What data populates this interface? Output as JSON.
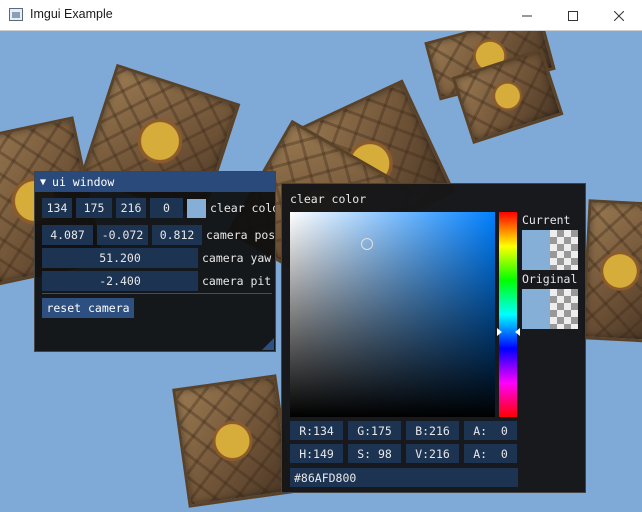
{
  "window": {
    "title": "Imgui Example",
    "minimize_icon": "minimize-icon",
    "maximize_icon": "maximize-icon",
    "close_icon": "close-icon"
  },
  "colors": {
    "background": "#86AFD8",
    "imgui_header": "#294A7A",
    "imgui_field": "#1D3352",
    "imgui_button": "#2D5080"
  },
  "ui_window": {
    "title": "ui window",
    "collapse_icon": "triangle-down-icon",
    "clear_color": {
      "r": "134",
      "g": "175",
      "b": "216",
      "a": "0",
      "label": "clear colo"
    },
    "camera_pos": {
      "x": "4.087",
      "y": "-0.072",
      "z": "0.812",
      "label": "camera pos"
    },
    "camera_yaw": {
      "value": "51.200",
      "label": "camera yaw"
    },
    "camera_pitch": {
      "value": "-2.400",
      "label": "camera pit"
    },
    "reset_button": "reset camera"
  },
  "color_picker": {
    "title": "clear color",
    "current_label": "Current",
    "original_label": "Original",
    "rgba": {
      "r": "R:134",
      "g": "G:175",
      "b": "B:216",
      "a": "A:  0"
    },
    "hsva": {
      "h": "H:149",
      "s": "S: 98",
      "v": "V:216",
      "a": "A:  0"
    },
    "hex": "#86AFD800"
  }
}
